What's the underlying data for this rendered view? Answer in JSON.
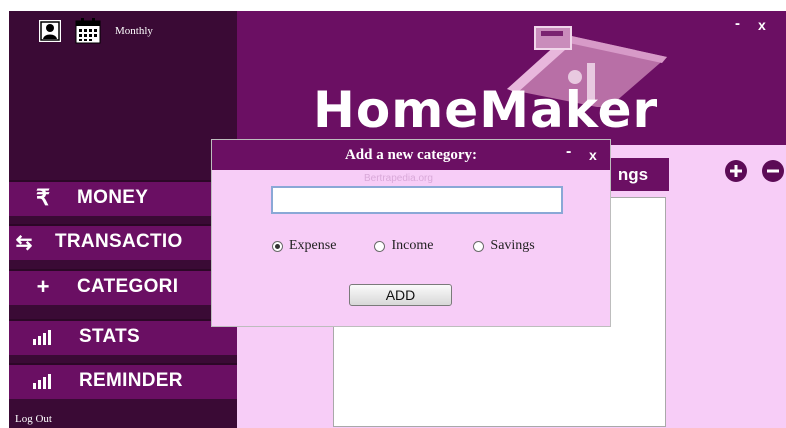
{
  "topbar": {
    "monthly_label": "Monthly",
    "icons": [
      "user-icon",
      "calendar-icon"
    ]
  },
  "sidebar": {
    "items": [
      {
        "label": "MONEY",
        "icon": "rupee-icon"
      },
      {
        "label": "TRANSACTIO",
        "icon": "transfer-arrows-icon"
      },
      {
        "label": "CATEGORI",
        "icon": "plus-icon"
      },
      {
        "label": "STATS",
        "icon": "bar-chart-icon"
      },
      {
        "label": "REMINDER",
        "icon": "bar-chart-icon"
      }
    ],
    "logout_label": "Log Out"
  },
  "header": {
    "logo_text": "HomeMaker",
    "minimize_label": "-",
    "close_label": "x"
  },
  "tabs": {
    "visible_tab_label": "ngs"
  },
  "dialog": {
    "title": "Add a new category:",
    "minimize_label": "-",
    "close_label": "x",
    "input_value": "",
    "watermark": "Bertrapedia.org",
    "radio_options": [
      "Expense",
      "Income",
      "Savings"
    ],
    "selected_option": "Expense",
    "add_label": "ADD"
  },
  "colors": {
    "sidebar_bg": "#3a0a35",
    "header_bg": "#6b0f63",
    "content_bg": "#f7cdf7"
  }
}
